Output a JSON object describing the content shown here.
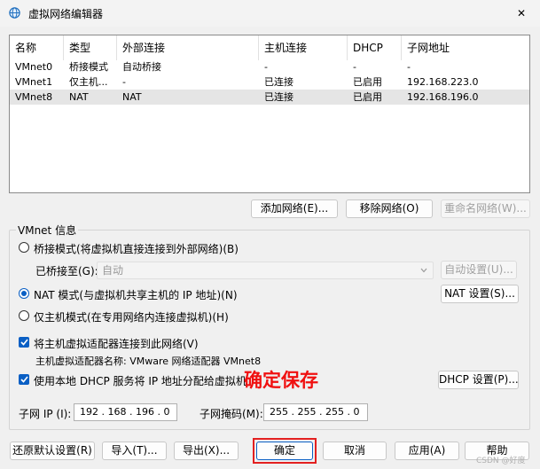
{
  "window": {
    "title": "虚拟网络编辑器",
    "close_glyph": "✕"
  },
  "network_table": {
    "columns": [
      "名称",
      "类型",
      "外部连接",
      "主机连接",
      "DHCP",
      "子网地址"
    ],
    "rows": [
      [
        "VMnet0",
        "桥接模式",
        "自动桥接",
        "-",
        "-",
        "-"
      ],
      [
        "VMnet1",
        "仅主机...",
        "-",
        "已连接",
        "已启用",
        "192.168.223.0"
      ],
      [
        "VMnet8",
        "NAT",
        "NAT",
        "已连接",
        "已启用",
        "192.168.196.0"
      ]
    ],
    "selected_row": 2
  },
  "table_buttons": {
    "add": "添加网络(E)...",
    "remove": "移除网络(O)",
    "rename": "重命名网络(W)..."
  },
  "vmnet_info": {
    "group_label": "VMnet 信息",
    "bridged_radio": "桥接模式(将虚拟机直接连接到外部网络)(B)",
    "bridged_to_label": "已桥接至(G):",
    "bridged_to_value": "自动",
    "auto_settings": "自动设置(U)...",
    "nat_radio": "NAT 模式(与虚拟机共享主机的 IP 地址)(N)",
    "nat_settings": "NAT 设置(S)...",
    "hostonly_radio": "仅主机模式(在专用网络内连接虚拟机)(H)",
    "connect_adapter_check": "将主机虚拟适配器连接到此网络(V)",
    "adapter_name": "主机虚拟适配器名称: VMware 网络适配器 VMnet8",
    "use_dhcp_check": "使用本地 DHCP 服务将 IP 地址分配给虚拟机(D)",
    "dhcp_settings": "DHCP 设置(P)...",
    "subnet_ip_label": "子网 IP (I):",
    "subnet_ip_value": "192 . 168 . 196 . 0",
    "subnet_mask_label": "子网掩码(M):",
    "subnet_mask_value": "255 . 255 . 255 . 0",
    "selected_mode": "nat"
  },
  "annotation": {
    "text": "确定保存",
    "color": "#f01010"
  },
  "bottom_buttons": {
    "restore": "还原默认设置(R)",
    "import": "导入(T)...",
    "export": "导出(X)...",
    "ok": "确定",
    "cancel": "取消",
    "apply": "应用(A)",
    "help": "帮助"
  },
  "watermark": "CSDN @好度",
  "colors": {
    "accent": "#0a5fc4",
    "highlight_box": "#e32020"
  }
}
